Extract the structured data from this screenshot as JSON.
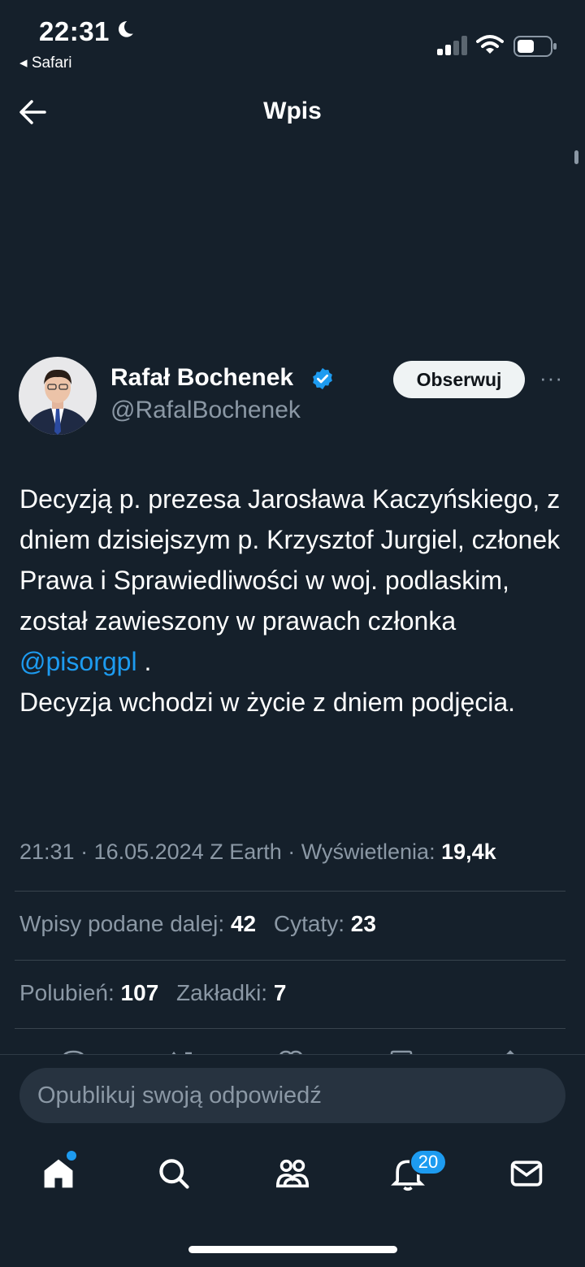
{
  "status_bar": {
    "time": "22:31",
    "back_app": "◂ Safari"
  },
  "header": {
    "title": "Wpis"
  },
  "author": {
    "name": "Rafał Bochenek",
    "handle": "@RafalBochenek",
    "follow_label": "Obserwuj",
    "more_label": "···"
  },
  "post": {
    "text_before": "Decyzją p. prezesa Jarosława Kaczyńskiego, z dniem dzisiejszym p. Krzysztof Jurgiel, członek Prawa i Sprawiedliwości w woj. podlaskim, został zawieszony w prawach członka",
    "mention": "@pisorgpl",
    "text_after_mention": " .",
    "text_last": "Decyzja wchodzi w życie z dniem podjęcia."
  },
  "meta": {
    "time": "21:31",
    "date": "16.05.2024",
    "source": "Z Earth",
    "views_label": "Wyświetlenia:",
    "views_value": "19,4k"
  },
  "stats": {
    "reposts_label": "Wpisy podane dalej:",
    "reposts_value": "42",
    "quotes_label": "Cytaty:",
    "quotes_value": "23",
    "likes_label": "Polubień:",
    "likes_value": "107",
    "bookmarks_label": "Zakładki:",
    "bookmarks_value": "7"
  },
  "reply": {
    "placeholder": "Opublikuj swoją odpowiedź"
  },
  "tabbar": {
    "notifications_badge": "20",
    "icons": [
      "home-icon",
      "search-icon",
      "communities-icon",
      "notifications-icon",
      "messages-icon"
    ]
  },
  "colors": {
    "background": "#15202b",
    "accent": "#1d9bf0",
    "muted": "#8b98a5"
  }
}
